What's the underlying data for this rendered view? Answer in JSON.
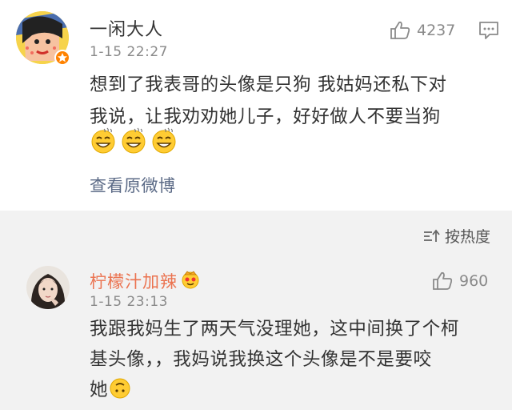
{
  "post": {
    "username": "一闲大人",
    "time": "1-15 22:27",
    "likes": "4237",
    "text_line1": "想到了我表哥的头像是只狗 我姑妈还私下对",
    "text_line2": "我说，让我劝劝她儿子，好好做人不要当狗",
    "emojis": [
      "sweat-smile-emoji",
      "sweat-smile-emoji",
      "sweat-smile-emoji"
    ],
    "view_original": "查看原微博"
  },
  "sort": {
    "label": "按热度",
    "icon": "sort-icon"
  },
  "reply": {
    "username": "柠檬汁加辣",
    "badge_icon": "crown-emoji-badge",
    "time": "1-15 23:13",
    "likes": "960",
    "text_line1": "我跟我妈生了两天气没理她，这中间换了个柯",
    "text_line2": "基头像，，我妈说我换这个头像是不是要咬",
    "text_line3": "她",
    "emoji": "upside-down-face-emoji"
  },
  "colors": {
    "accent_username": "#eb7350",
    "link": "#5b6a86",
    "muted": "#8a8a8a",
    "section_bg": "#f2f2f2"
  }
}
